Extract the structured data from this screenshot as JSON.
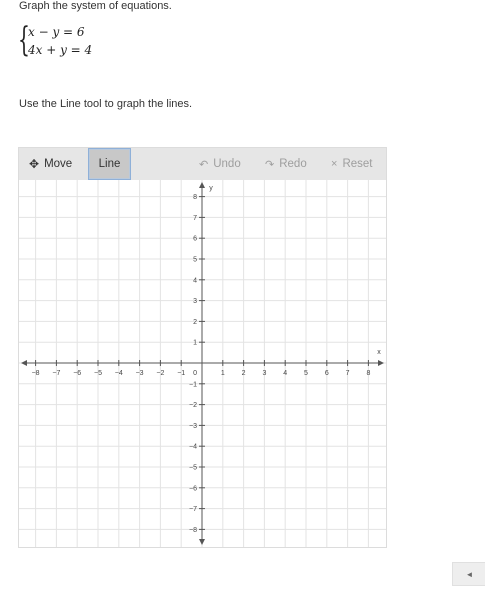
{
  "prompt": "Graph the system of equations.",
  "system": {
    "equations": [
      "x − y = 6",
      "4x + y = 4"
    ]
  },
  "instruction": "Use the Line tool to graph the lines.",
  "toolbar": {
    "move_label": "Move",
    "line_label": "Line",
    "undo_label": "Undo",
    "redo_label": "Redo",
    "reset_label": "Reset",
    "active_tool": "Line"
  },
  "graph": {
    "x_axis_label": "x",
    "y_axis_label": "y",
    "x_range": [
      -8,
      8
    ],
    "y_range": [
      -8,
      8
    ],
    "x_ticks": [
      "−8",
      "−7",
      "−6",
      "−5",
      "−4",
      "−3",
      "−2",
      "−1",
      "1",
      "2",
      "3",
      "4",
      "5",
      "6",
      "7",
      "8"
    ],
    "y_ticks": [
      "8",
      "7",
      "6",
      "5",
      "4",
      "3",
      "2",
      "1",
      "−1",
      "−2",
      "−3",
      "−4",
      "−5",
      "−6",
      "−7",
      "−8"
    ],
    "origin_label": "0",
    "colors": {
      "grid": "#e3e3e3",
      "axis": "#555555"
    }
  },
  "scroll": {
    "icon": "left-arrow-icon"
  }
}
